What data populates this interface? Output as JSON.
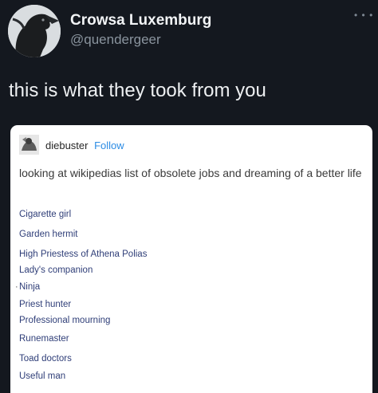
{
  "tweet": {
    "display_name": "Crowsa Luxemburg",
    "handle": "@quendergeer",
    "more_icon": "ellipsis-icon",
    "avatar_icon": "crow-avatar",
    "text": "this is what they took from you"
  },
  "post": {
    "username": "diebuster",
    "follow_label": "Follow",
    "body": "looking at wikipedias list of obsolete jobs and dreaming of a better life",
    "jobs": [
      "Cigarette girl",
      "Garden hermit",
      "High Priestess of Athena Polias",
      "Lady's companion",
      "Ninja",
      "Priest hunter",
      "Professional mourning",
      "Runemaster",
      "Toad doctors",
      "Useful man"
    ]
  },
  "colors": {
    "background": "#14181f",
    "link": "#2f3e78",
    "follow": "#2c8ce4"
  }
}
